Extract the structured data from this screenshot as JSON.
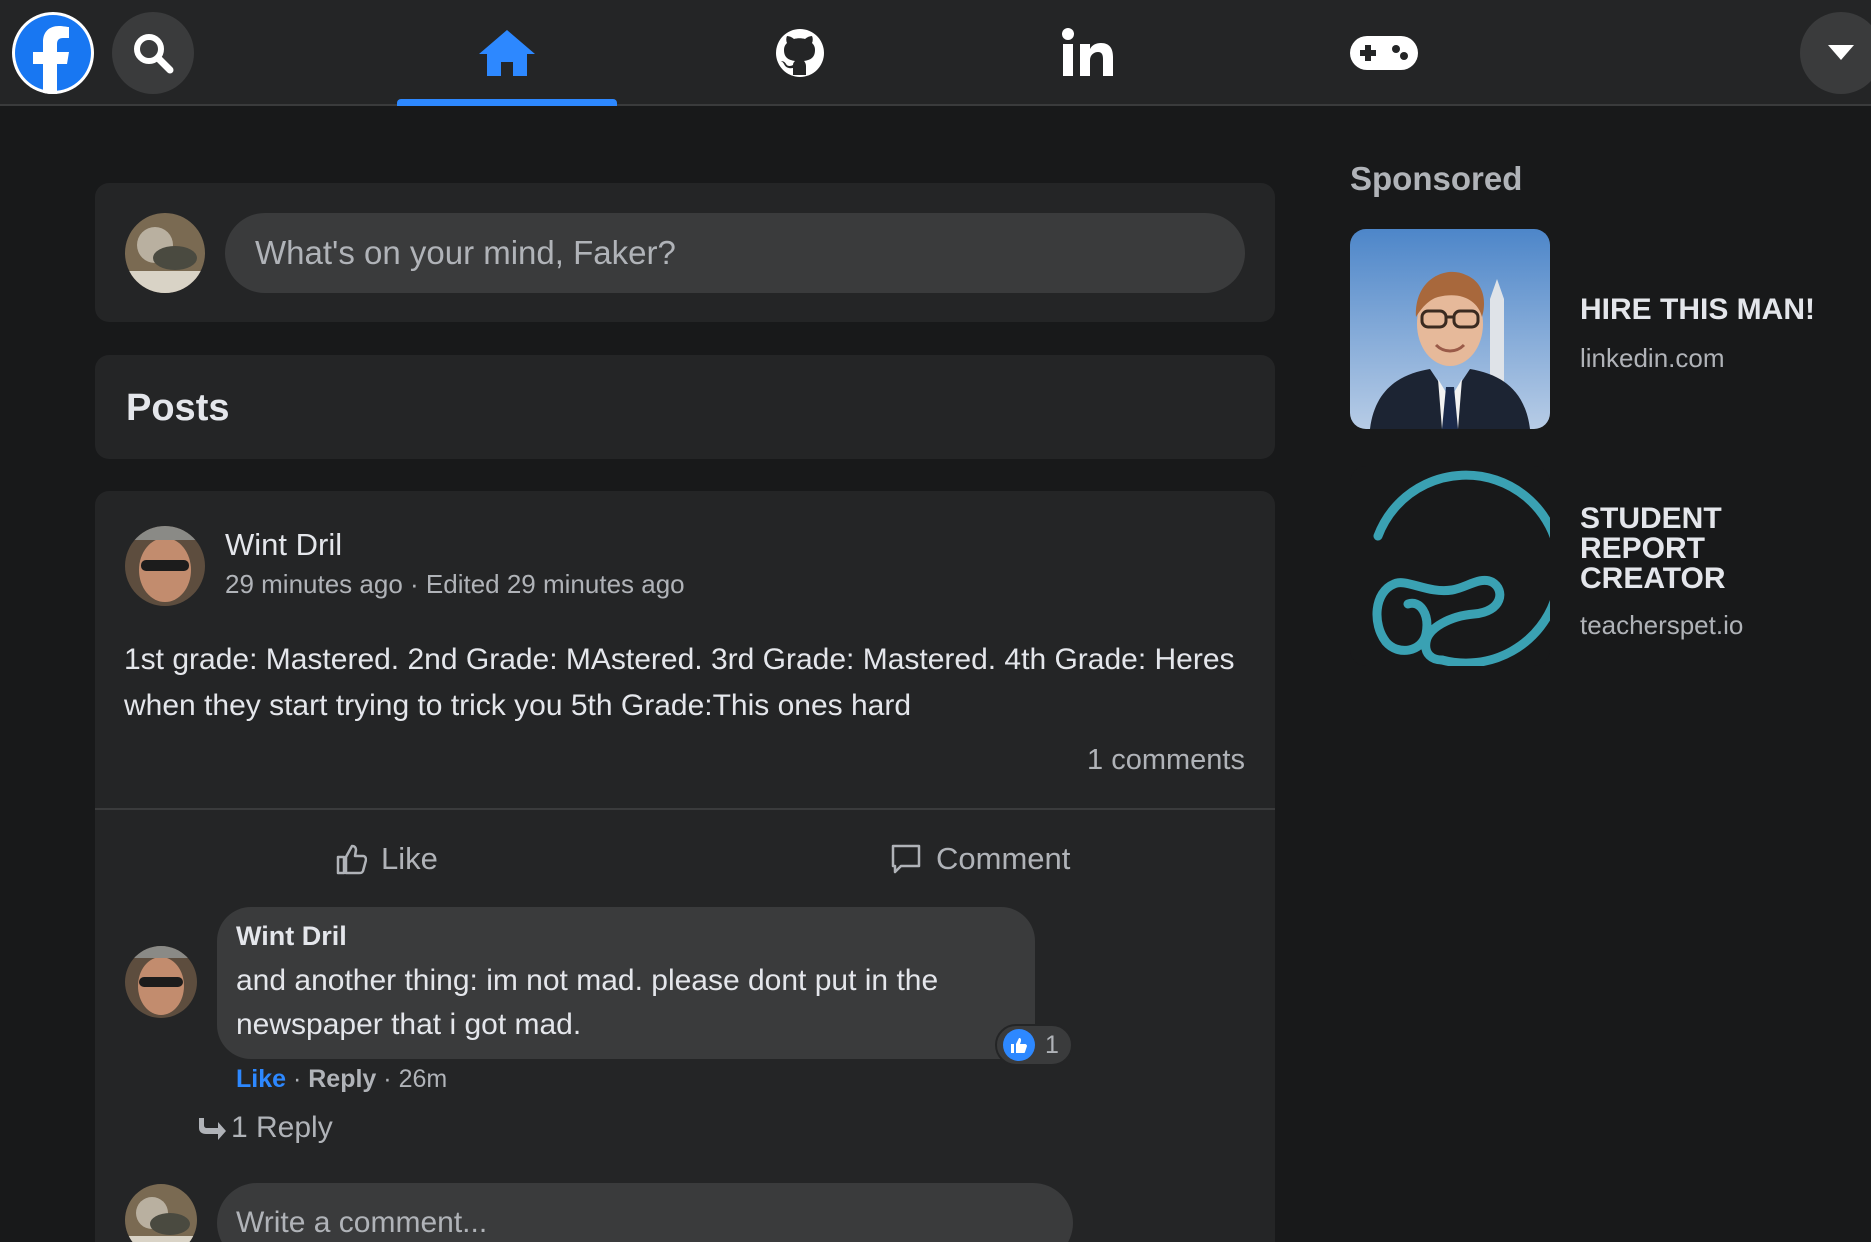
{
  "nav": {
    "tabs": [
      {
        "name": "home",
        "active": true
      },
      {
        "name": "github",
        "active": false
      },
      {
        "name": "linkedin",
        "active": false
      },
      {
        "name": "gaming",
        "active": false
      }
    ],
    "accent_color": "#2d88ff"
  },
  "composer": {
    "placeholder": "What's on your mind, Faker?"
  },
  "posts_header": {
    "title": "Posts"
  },
  "post": {
    "author": "Wint Dril",
    "time": "29 minutes ago",
    "separator": " · ",
    "edited": "Edited 29 minutes ago",
    "body": "1st grade: Mastered. 2nd Grade: MAstered. 3rd Grade: Mastered. 4th Grade: Heres when they start trying to trick you 5th Grade:This ones hard",
    "comment_count": "1 comments",
    "like_label": "Like",
    "comment_label": "Comment",
    "comment": {
      "author": "Wint Dril",
      "text": "and another thing: im not mad. please dont put in the newspaper that i got mad.",
      "reaction_count": "1",
      "like_label": "Like",
      "reply_label": "Reply",
      "age": "26m",
      "dot": " · "
    },
    "replies_label": "1 Reply",
    "write_comment_placeholder": "Write a comment..."
  },
  "sponsored": {
    "title": "Sponsored",
    "ads": [
      {
        "title": "HIRE THIS MAN!",
        "domain": "linkedin.com"
      },
      {
        "title": "STUDENT REPORT CREATOR",
        "domain": "teacherspet.io"
      }
    ]
  }
}
